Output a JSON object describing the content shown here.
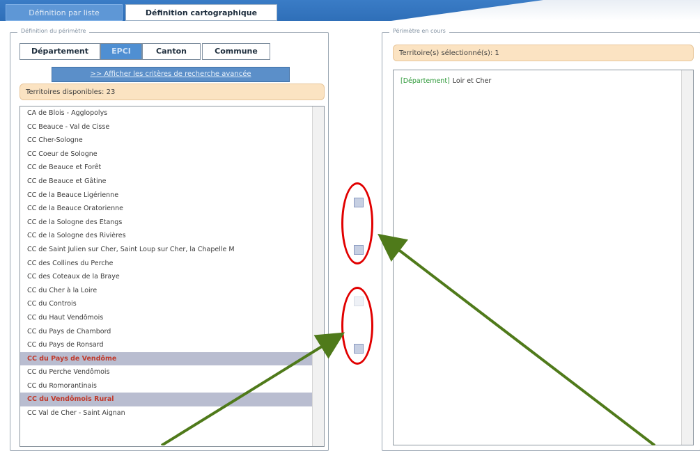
{
  "header": {
    "tabs": [
      {
        "label": "Définition par liste",
        "active": false
      },
      {
        "label": "Définition cartographique",
        "active": true
      }
    ]
  },
  "left_panel": {
    "legend": "Définition du périmètre",
    "subtabs": [
      {
        "label": "Département",
        "active": false
      },
      {
        "label": "EPCI",
        "active": true
      },
      {
        "label": "Canton",
        "active": false
      },
      {
        "label": "Commune",
        "active": false
      }
    ],
    "criteria_button": ">> Afficher les critères de recherche avancée",
    "available_label": "Territoires disponibles: 23",
    "items": [
      {
        "label": "CA de Blois - Agglopolys",
        "selected": false
      },
      {
        "label": "CC Beauce - Val de Cisse",
        "selected": false
      },
      {
        "label": "CC Cher-Sologne",
        "selected": false
      },
      {
        "label": "CC Coeur de Sologne",
        "selected": false
      },
      {
        "label": "CC de Beauce et Forêt",
        "selected": false
      },
      {
        "label": "CC de Beauce et Gâtine",
        "selected": false
      },
      {
        "label": "CC de la Beauce Ligérienne",
        "selected": false
      },
      {
        "label": "CC de la Beauce Oratorienne",
        "selected": false
      },
      {
        "label": "CC de la Sologne des Etangs",
        "selected": false
      },
      {
        "label": "CC de la Sologne des Rivières",
        "selected": false
      },
      {
        "label": "CC de Saint Julien sur Cher, Saint Loup sur Cher, la Chapelle M",
        "selected": false
      },
      {
        "label": "CC des Collines du Perche",
        "selected": false
      },
      {
        "label": "CC des Coteaux de la Braye",
        "selected": false
      },
      {
        "label": "CC du Cher à la Loire",
        "selected": false
      },
      {
        "label": "CC du Controis",
        "selected": false
      },
      {
        "label": "CC du Haut Vendômois",
        "selected": false
      },
      {
        "label": "CC du Pays de Chambord",
        "selected": false
      },
      {
        "label": "CC du Pays de Ronsard",
        "selected": false
      },
      {
        "label": "CC du Pays de Vendôme",
        "selected": true
      },
      {
        "label": "CC du Perche Vendômois",
        "selected": false
      },
      {
        "label": "CC du Romorantinais",
        "selected": false
      },
      {
        "label": "CC du Vendômois Rural",
        "selected": true
      },
      {
        "label": "CC Val de Cher - Saint Aignan",
        "selected": false
      }
    ]
  },
  "right_panel": {
    "legend": "Périmètre en cours",
    "selected_label": "Territoire(s) sélectionné(s): 1",
    "entries": [
      {
        "type": "[Département]",
        "name": "Loir et Cher"
      }
    ]
  },
  "icons": {
    "add": "add-arrow-icon",
    "add_all": "add-all-arrow-icon",
    "remove": "remove-arrow-icon",
    "remove_all": "remove-all-arrow-icon"
  },
  "colors": {
    "brand_blue": "#3a7cc6",
    "annotation_red": "#e10000",
    "annotation_green": "#4f7a1a",
    "selected_row": "#b9bdd0",
    "selected_text": "#c0392b",
    "info_bar": "#fbe3c2"
  }
}
